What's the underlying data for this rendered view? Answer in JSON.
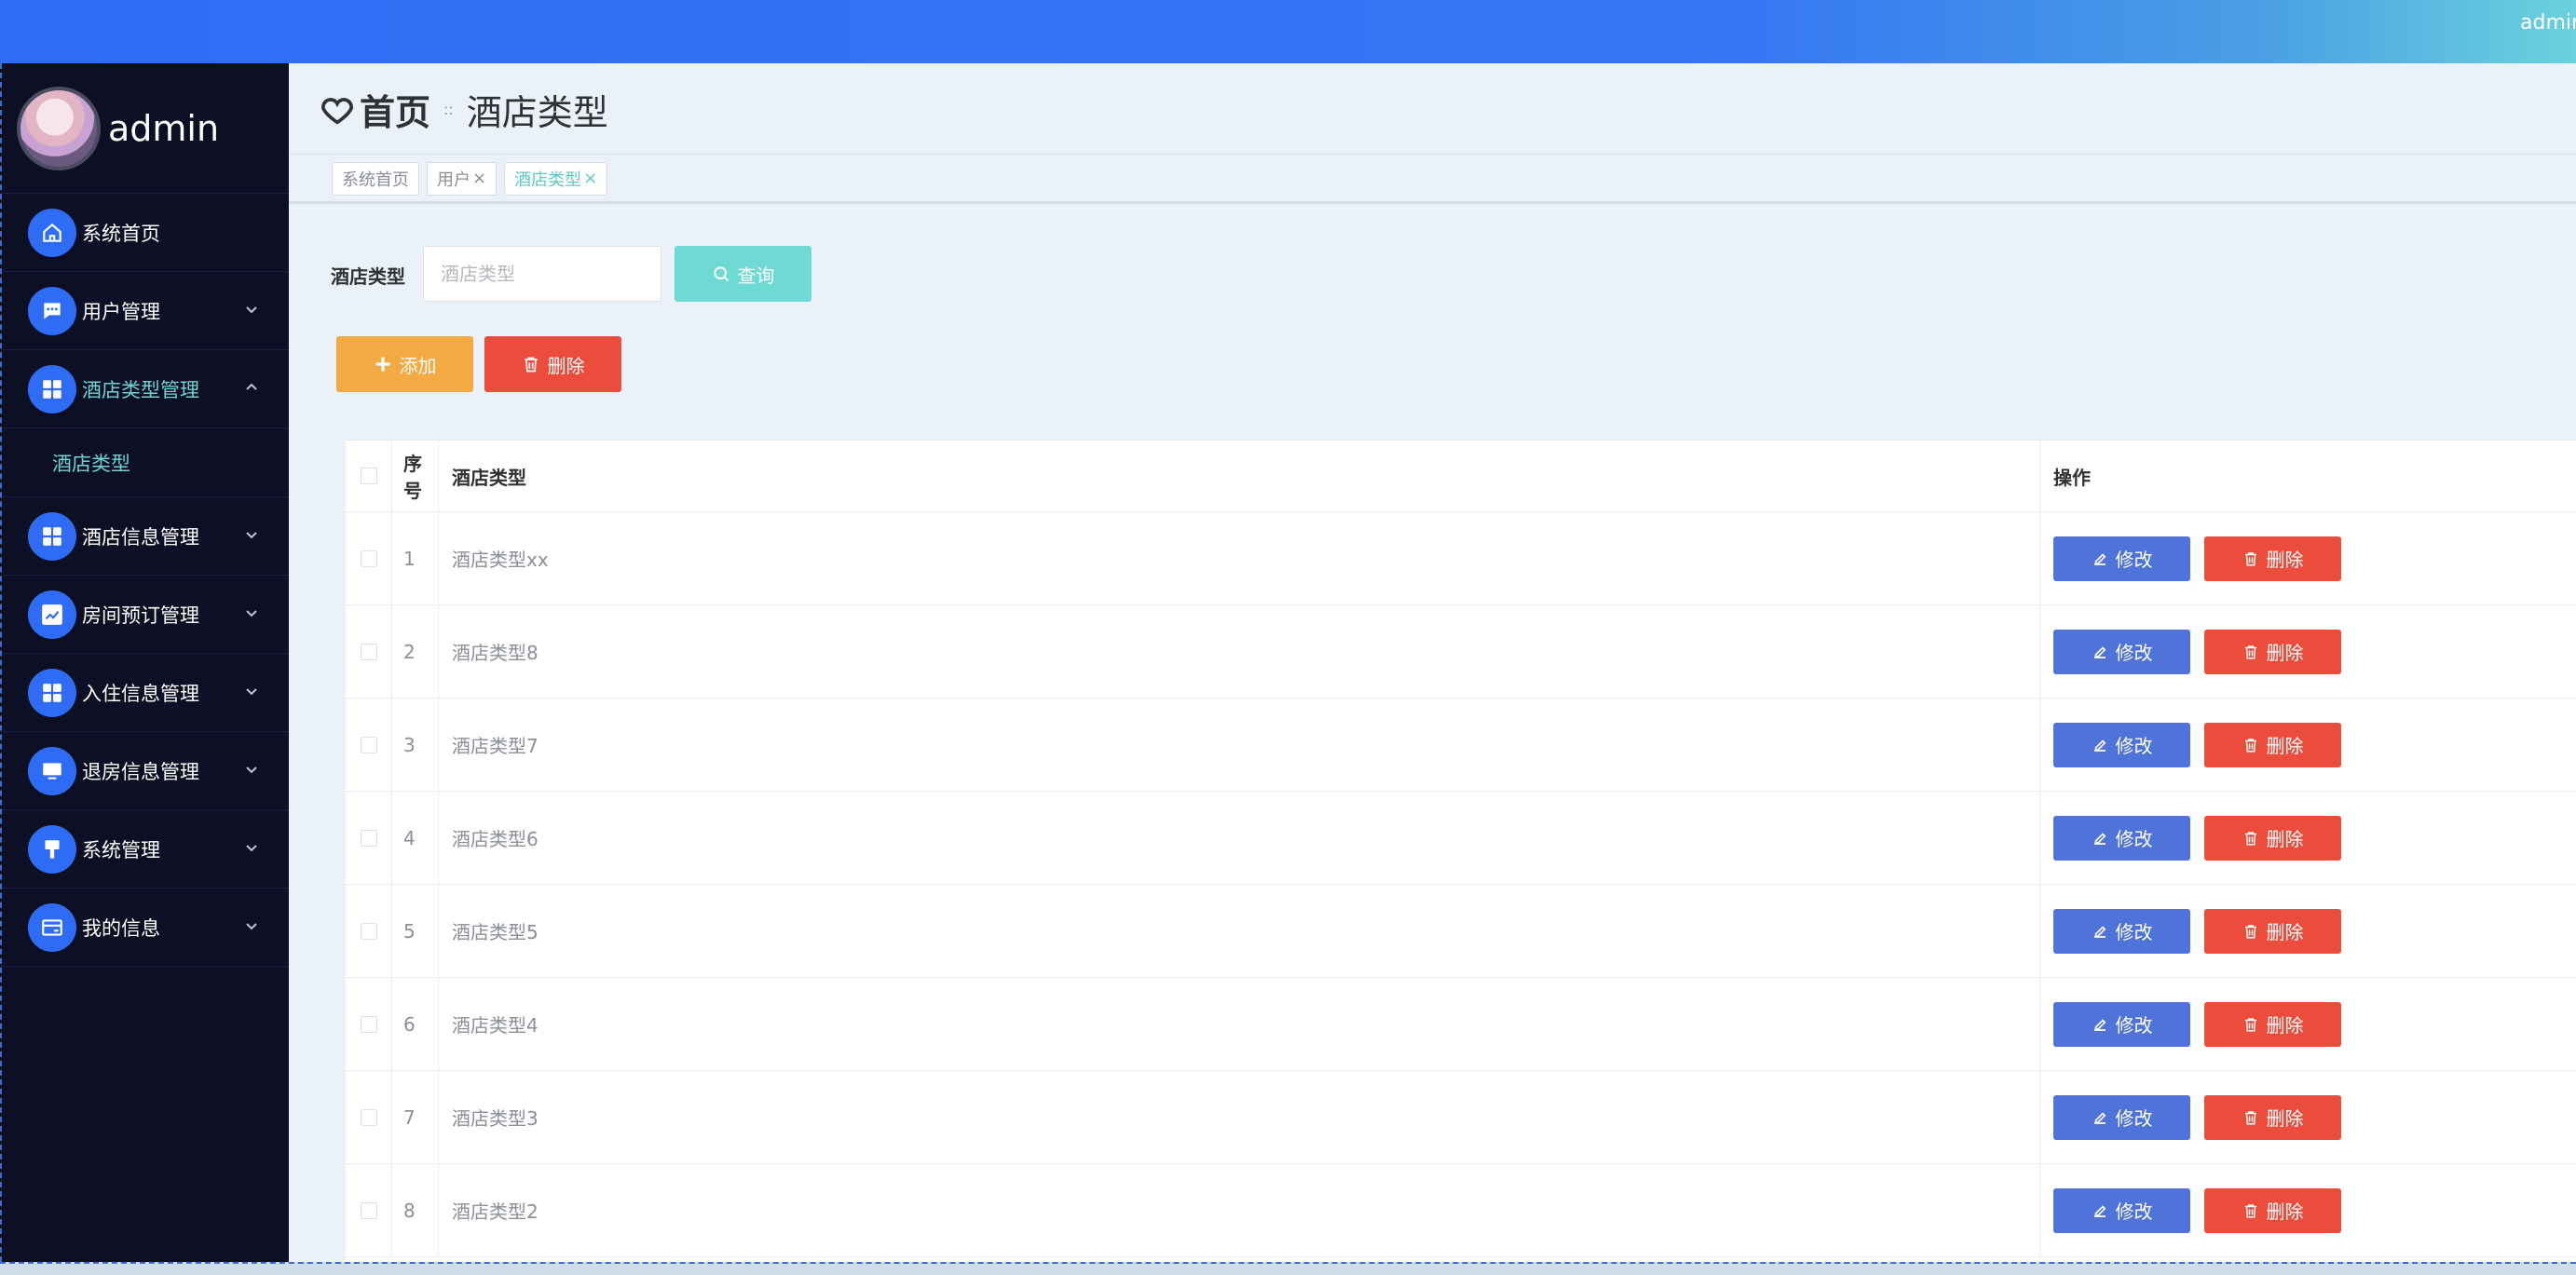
{
  "topbar": {
    "user": "admin"
  },
  "sidebar": {
    "username": "admin",
    "items": [
      {
        "label": "系统首页",
        "icon": "home-icon",
        "expandable": false
      },
      {
        "label": "用户管理",
        "icon": "chat-icon",
        "expandable": true
      },
      {
        "label": "酒店类型管理",
        "icon": "grid-icon",
        "expandable": true,
        "expanded": true
      },
      {
        "label": "酒店信息管理",
        "icon": "grid-icon",
        "expandable": true
      },
      {
        "label": "房间预订管理",
        "icon": "chart-icon",
        "expandable": true
      },
      {
        "label": "入住信息管理",
        "icon": "grid-icon",
        "expandable": true
      },
      {
        "label": "退房信息管理",
        "icon": "monitor-icon",
        "expandable": true
      },
      {
        "label": "系统管理",
        "icon": "brush-icon",
        "expandable": true
      },
      {
        "label": "我的信息",
        "icon": "card-icon",
        "expandable": true
      }
    ],
    "submenu": {
      "label": "酒店类型"
    }
  },
  "header": {
    "home": "首页",
    "separator": "::",
    "current": "酒店类型"
  },
  "tags": [
    {
      "label": "系统首页",
      "closable": false
    },
    {
      "label": "用户",
      "closable": true
    },
    {
      "label": "酒店类型",
      "closable": true,
      "active": true
    }
  ],
  "search": {
    "label": "酒店类型",
    "placeholder": "酒店类型",
    "value": "",
    "button": "查询"
  },
  "actions": {
    "add": "添加",
    "delete": "删除"
  },
  "table": {
    "columns": {
      "index": "序号",
      "type": "酒店类型",
      "op": "操作"
    },
    "rows": [
      {
        "index": "1",
        "type": "酒店类型xx"
      },
      {
        "index": "2",
        "type": "酒店类型8"
      },
      {
        "index": "3",
        "type": "酒店类型7"
      },
      {
        "index": "4",
        "type": "酒店类型6"
      },
      {
        "index": "5",
        "type": "酒店类型5"
      },
      {
        "index": "6",
        "type": "酒店类型4"
      },
      {
        "index": "7",
        "type": "酒店类型3"
      },
      {
        "index": "8",
        "type": "酒店类型2"
      }
    ],
    "edit_label": "修改",
    "delete_label": "删除"
  },
  "colors": {
    "primary": "#2f6cf5",
    "sidebar_bg": "#0d1024",
    "active_text": "#6fd3d0",
    "query": "#6fd9d3",
    "add": "#f4aa42",
    "danger": "#ec4c3c",
    "edit": "#4f73d9"
  }
}
